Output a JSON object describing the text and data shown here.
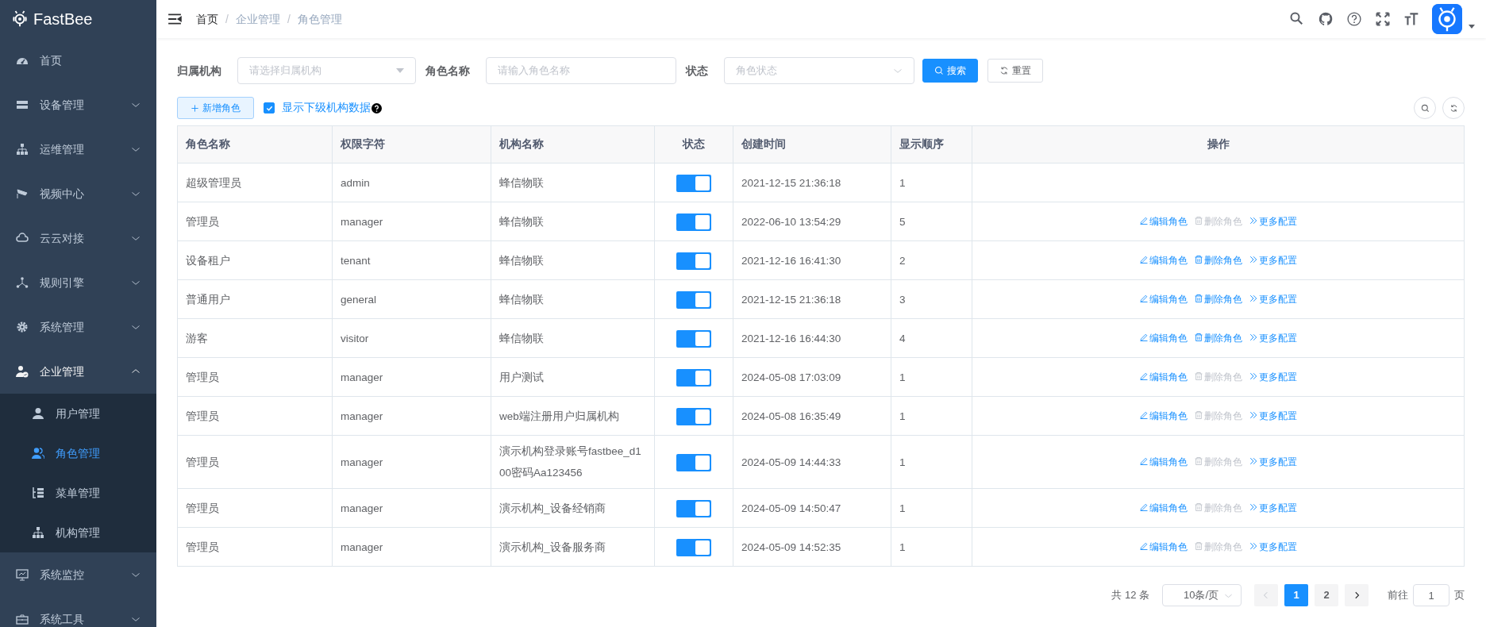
{
  "sidebar": {
    "logo": "FastBee",
    "items": [
      {
        "label": "首页"
      },
      {
        "label": "设备管理",
        "expanded": false
      },
      {
        "label": "运维管理",
        "expanded": false
      },
      {
        "label": "视频中心",
        "expanded": false
      },
      {
        "label": "云云对接",
        "expanded": false
      },
      {
        "label": "规则引擎",
        "expanded": false
      },
      {
        "label": "系统管理",
        "expanded": false
      },
      {
        "label": "企业管理",
        "expanded": true,
        "children": [
          {
            "label": "用户管理",
            "selected": false
          },
          {
            "label": "角色管理",
            "selected": true
          },
          {
            "label": "菜单管理",
            "selected": false
          },
          {
            "label": "机构管理",
            "selected": false
          }
        ]
      },
      {
        "label": "系统监控",
        "expanded": false
      },
      {
        "label": "系统工具",
        "expanded": false
      }
    ]
  },
  "breadcrumb": [
    {
      "label": "首页"
    },
    {
      "separator": "/",
      "label": "企业管理"
    },
    {
      "separator": "/",
      "label": "角色管理"
    }
  ],
  "filters": [
    {
      "label": "归属机构",
      "placeholder": "请选择归属机构",
      "kind": "tree-select"
    },
    {
      "label": "角色名称",
      "placeholder": "请输入角色名称",
      "kind": "input"
    },
    {
      "label": "状态",
      "placeholder": "角色状态",
      "kind": "select"
    }
  ],
  "search_buttons": [
    {
      "kind": "primary",
      "label": "搜索"
    },
    {
      "kind": "reset",
      "label": "重置"
    }
  ],
  "toolbar": {
    "add_button": "新增角色",
    "checkbox": {
      "label": "显示下级机构数据",
      "checked": true
    }
  },
  "table": {
    "columns": [
      "角色名称",
      "权限字符",
      "机构名称",
      "状态",
      "创建时间",
      "显示顺序",
      "操作"
    ],
    "rows": [
      {
        "name": "超级管理员",
        "key": "admin",
        "org": "蜂信物联",
        "on": true,
        "created": "2021-12-15 21:36:18",
        "order": "1"
      },
      {
        "name": "管理员",
        "key": "manager",
        "org": "蜂信物联",
        "on": true,
        "created": "2022-06-10 13:54:29",
        "order": "5",
        "actions": [
          {
            "kind": "edit",
            "label": "编辑角色",
            "disabled": false
          },
          {
            "kind": "delete",
            "label": "删除角色",
            "disabled": true
          },
          {
            "kind": "more",
            "label": "更多配置",
            "disabled": false
          }
        ]
      },
      {
        "name": "设备租户",
        "key": "tenant",
        "org": "蜂信物联",
        "on": true,
        "created": "2021-12-16 16:41:30",
        "order": "2",
        "actions": [
          {
            "kind": "edit",
            "label": "编辑角色",
            "disabled": false
          },
          {
            "kind": "delete",
            "label": "删除角色",
            "disabled": false
          },
          {
            "kind": "more",
            "label": "更多配置",
            "disabled": false
          }
        ]
      },
      {
        "name": "普通用户",
        "key": "general",
        "org": "蜂信物联",
        "on": true,
        "created": "2021-12-15 21:36:18",
        "order": "3",
        "actions": [
          {
            "kind": "edit",
            "label": "编辑角色",
            "disabled": false
          },
          {
            "kind": "delete",
            "label": "删除角色",
            "disabled": false
          },
          {
            "kind": "more",
            "label": "更多配置",
            "disabled": false
          }
        ]
      },
      {
        "name": "游客",
        "key": "visitor",
        "org": "蜂信物联",
        "on": true,
        "created": "2021-12-16 16:44:30",
        "order": "4",
        "actions": [
          {
            "kind": "edit",
            "label": "编辑角色",
            "disabled": false
          },
          {
            "kind": "delete",
            "label": "删除角色",
            "disabled": false
          },
          {
            "kind": "more",
            "label": "更多配置",
            "disabled": false
          }
        ]
      },
      {
        "name": "管理员",
        "key": "manager",
        "org": "用户测试",
        "on": true,
        "created": "2024-05-08 17:03:09",
        "order": "1",
        "actions": [
          {
            "kind": "edit",
            "label": "编辑角色",
            "disabled": false
          },
          {
            "kind": "delete",
            "label": "删除角色",
            "disabled": true
          },
          {
            "kind": "more",
            "label": "更多配置",
            "disabled": false
          }
        ]
      },
      {
        "name": "管理员",
        "key": "manager",
        "org": "web端注册用户归属机构",
        "on": true,
        "created": "2024-05-08 16:35:49",
        "order": "1",
        "actions": [
          {
            "kind": "edit",
            "label": "编辑角色",
            "disabled": false
          },
          {
            "kind": "delete",
            "label": "删除角色",
            "disabled": true
          },
          {
            "kind": "more",
            "label": "更多配置",
            "disabled": false
          }
        ]
      },
      {
        "name": "管理员",
        "key": "manager",
        "org": "演示机构登录账号fastbee_d100密码Aa123456",
        "on": true,
        "created": "2024-05-09 14:44:33",
        "order": "1",
        "actions": [
          {
            "kind": "edit",
            "label": "编辑角色",
            "disabled": false
          },
          {
            "kind": "delete",
            "label": "删除角色",
            "disabled": true
          },
          {
            "kind": "more",
            "label": "更多配置",
            "disabled": false
          }
        ]
      },
      {
        "name": "管理员",
        "key": "manager",
        "org": "演示机构_设备经销商",
        "on": true,
        "created": "2024-05-09 14:50:47",
        "order": "1",
        "actions": [
          {
            "kind": "edit",
            "label": "编辑角色",
            "disabled": false
          },
          {
            "kind": "delete",
            "label": "删除角色",
            "disabled": true
          },
          {
            "kind": "more",
            "label": "更多配置",
            "disabled": false
          }
        ]
      },
      {
        "name": "管理员",
        "key": "manager",
        "org": "演示机构_设备服务商",
        "on": true,
        "created": "2024-05-09 14:52:35",
        "order": "1",
        "actions": [
          {
            "kind": "edit",
            "label": "编辑角色",
            "disabled": false
          },
          {
            "kind": "delete",
            "label": "删除角色",
            "disabled": true
          },
          {
            "kind": "more",
            "label": "更多配置",
            "disabled": false
          }
        ]
      }
    ]
  },
  "pagination": {
    "total": "共 12 条",
    "page_size": "10条/页",
    "pages": [
      {
        "label": "1",
        "selected": true
      },
      {
        "label": "2",
        "selected": false
      }
    ],
    "goto_label": "前往",
    "goto_value": "1",
    "goto_suffix": "页"
  }
}
